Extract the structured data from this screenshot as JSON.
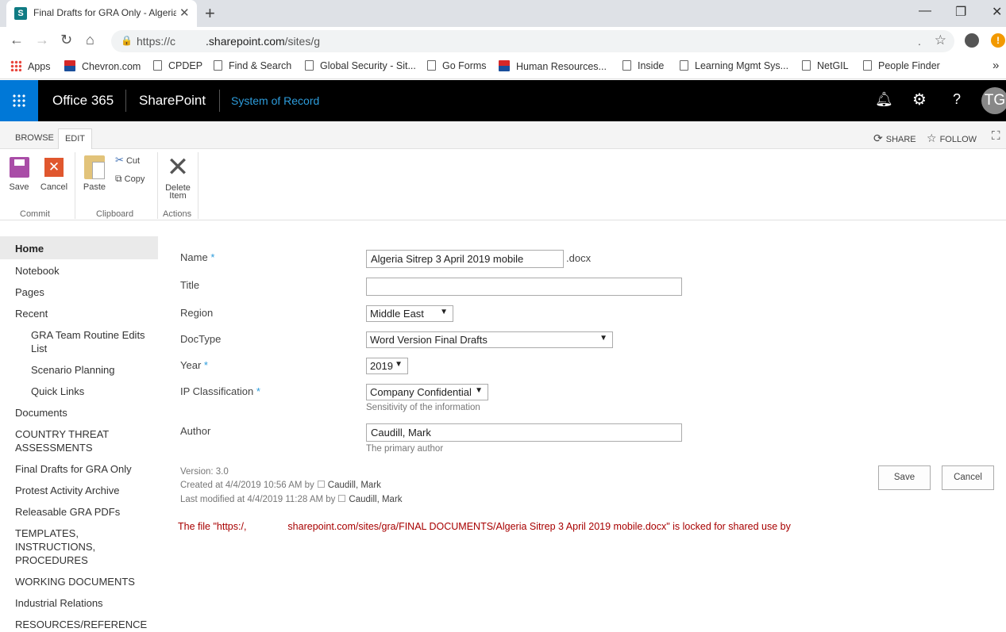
{
  "browser": {
    "tab_title": "Final Drafts for GRA Only - Algeria Sitrep",
    "tab_favicon": "S",
    "url_prefix": "https://",
    "url_partial": "c",
    "url_domain": ".sharepoint.com",
    "url_path": "/sites/g",
    "url_dot": ".",
    "alert_glyph": "!",
    "bookmarks": [
      "Apps",
      "Chevron.com",
      "CPDEP",
      "Find & Search",
      "Global Security - Sit...",
      "Go Forms",
      "Human Resources...",
      "Inside",
      "Learning Mgmt Sys...",
      "NetGIL",
      "People Finder"
    ],
    "more_bookmarks": "»"
  },
  "suitebar": {
    "app": "Office 365",
    "product": "SharePoint",
    "site_title": "System of Record",
    "avatar_initials": "TG"
  },
  "ribbon": {
    "tabs": {
      "browse": "BROWSE",
      "edit": "EDIT"
    },
    "share": "SHARE",
    "follow": "FOLLOW",
    "groups": {
      "commit": {
        "label": "Commit",
        "save": "Save",
        "cancel": "Cancel"
      },
      "clipboard": {
        "label": "Clipboard",
        "paste": "Paste",
        "cut": "Cut",
        "copy": "Copy"
      },
      "actions": {
        "label": "Actions",
        "delete_line1": "Delete",
        "delete_line2": "Item"
      }
    }
  },
  "leftnav": {
    "home": "Home",
    "notebook": "Notebook",
    "pages": "Pages",
    "recent": "Recent",
    "recent_items": [
      "GRA Team Routine Edits",
      "List",
      "Scenario Planning",
      "Quick Links"
    ],
    "documents": "Documents",
    "country_threat_1": "COUNTRY THREAT",
    "country_threat_2": "ASSESSMENTS",
    "final_drafts": "Final Drafts for GRA Only",
    "protest": "Protest Activity Archive",
    "releasable": "Releasable GRA PDFs",
    "templates_1": "TEMPLATES,",
    "templates_2": "INSTRUCTIONS,",
    "templates_3": "PROCEDURES",
    "working": "WORKING DOCUMENTS",
    "industrial": "Industrial Relations",
    "resources": "RESOURCES/REFERENCE"
  },
  "form": {
    "name_label": "Name",
    "name_value": "Algeria Sitrep 3 April 2019 mobile",
    "name_ext": ".docx",
    "title_label": "Title",
    "title_value": "",
    "region_label": "Region",
    "region_value": "Middle East",
    "doctype_label": "DocType",
    "doctype_value": "Word Version Final Drafts",
    "year_label": "Year",
    "year_value": "2019",
    "ip_label": "IP Classification",
    "ip_value": "Company Confidential",
    "ip_hint": "Sensitivity of the information",
    "author_label": "Author",
    "author_value": "Caudill, Mark",
    "author_hint": "The primary author",
    "required_mark": "*",
    "caret": "▼"
  },
  "meta": {
    "version": "Version: 3.0",
    "created": "Created at 4/4/2019 10:56 AM  by",
    "created_by": "Caudill, Mark",
    "modified": "Last modified at 4/4/2019 11:28 AM  by",
    "modified_by": "Caudill, Mark"
  },
  "buttons": {
    "save": "Save",
    "cancel": "Cancel"
  },
  "lock_message": {
    "part1": "The file \"https:/,",
    "part2": "sharepoint.com/sites/gra/FINAL DOCUMENTS/Algeria Sitrep 3 April 2019 mobile.docx\" is locked for shared use by"
  },
  "colors": {
    "suite_bg": "#000000",
    "waffle_bg": "#0078d7",
    "site_title": "#2d9cdb",
    "lock_message": "#a80000"
  }
}
